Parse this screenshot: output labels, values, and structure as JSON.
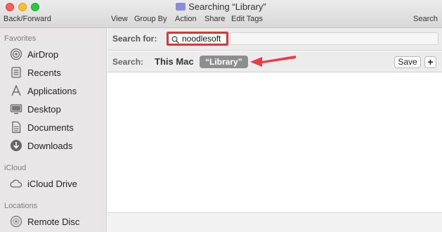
{
  "window": {
    "title": "Searching “Library”"
  },
  "toolbar": {
    "back_forward": "Back/Forward",
    "view": "View",
    "group_by": "Group By",
    "action": "Action",
    "share": "Share",
    "edit_tags": "Edit Tags",
    "search": "Search"
  },
  "sidebar": {
    "favorites_heading": "Favorites",
    "favorites": [
      {
        "label": "AirDrop",
        "icon": "airdrop-icon"
      },
      {
        "label": "Recents",
        "icon": "recents-icon"
      },
      {
        "label": "Applications",
        "icon": "applications-icon"
      },
      {
        "label": "Desktop",
        "icon": "desktop-icon"
      },
      {
        "label": "Documents",
        "icon": "documents-icon"
      },
      {
        "label": "Downloads",
        "icon": "downloads-icon"
      }
    ],
    "icloud_heading": "iCloud",
    "icloud": [
      {
        "label": "iCloud Drive",
        "icon": "cloud-icon"
      }
    ],
    "locations_heading": "Locations",
    "locations": [
      {
        "label": "Remote Disc",
        "icon": "disc-icon"
      }
    ]
  },
  "search_bar": {
    "label": "Search for:",
    "value": "noodlesoft"
  },
  "scope_bar": {
    "label": "Search:",
    "this_mac": "This Mac",
    "library": "“Library”",
    "save": "Save",
    "add": "+"
  },
  "colors": {
    "highlight": "#e0343b",
    "scope_selected": "#8e8e8e"
  }
}
